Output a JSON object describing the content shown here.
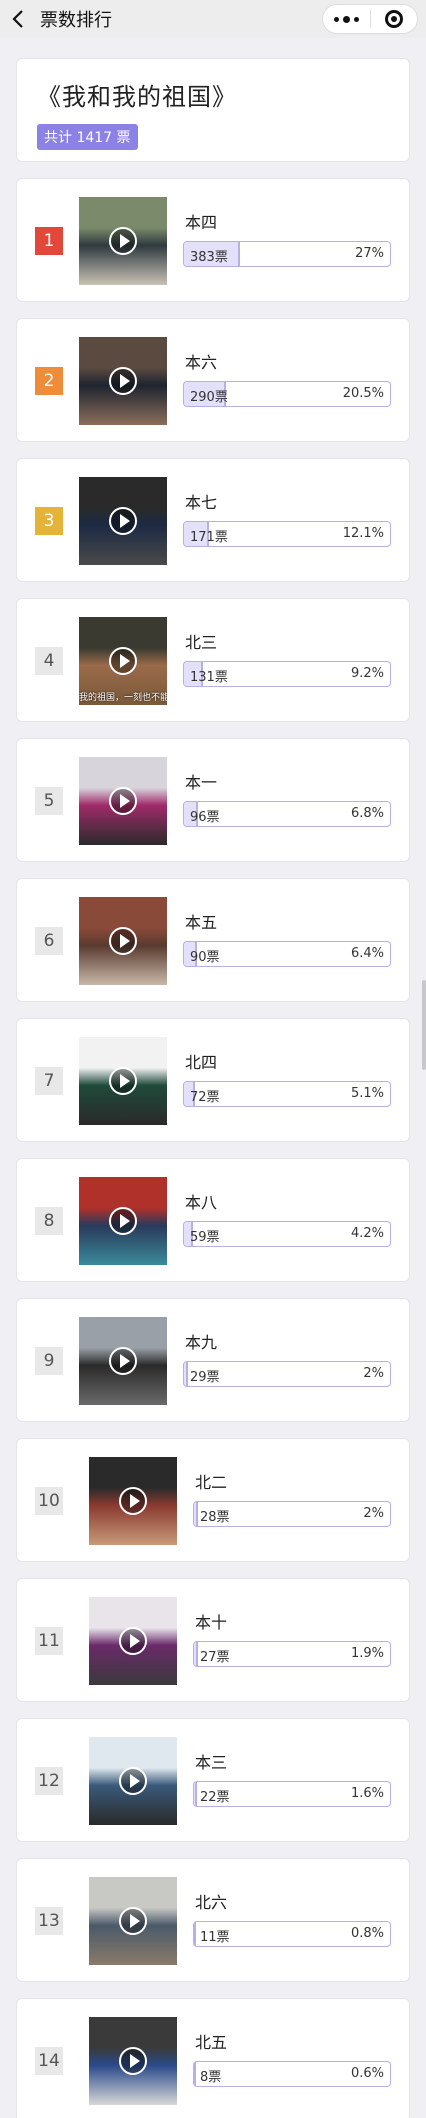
{
  "nav": {
    "title": "票数排行",
    "back_icon": "chevron-left-icon",
    "more_icon": "more-dots-icon",
    "close_icon": "mini-program-close-icon"
  },
  "summary": {
    "name": "《我和我的祖国》",
    "total": "共计 1417 票"
  },
  "colors": {
    "accent": "#8c82e6",
    "rank1": "#e2483a",
    "rank2": "#ee8c3a",
    "rank3": "#e5b23a",
    "bar_border": "#b6b0e8",
    "bar_fill": "#e3e0fa"
  },
  "items": [
    {
      "rank": "1",
      "cls": "本四",
      "votes": "383票",
      "pct": "27%",
      "share": 0.27,
      "thumb": [
        "#7a8a6a",
        "#2f3a40",
        "#c9c2b6"
      ],
      "caption": ""
    },
    {
      "rank": "2",
      "cls": "本六",
      "votes": "290票",
      "pct": "20.5%",
      "share": 0.205,
      "thumb": [
        "#5a4a40",
        "#1e2430",
        "#8b6e5a"
      ],
      "caption": ""
    },
    {
      "rank": "3",
      "cls": "本七",
      "votes": "171票",
      "pct": "12.1%",
      "share": 0.121,
      "thumb": [
        "#2a2a2a",
        "#1d2a44",
        "#4a4a4a"
      ],
      "caption": ""
    },
    {
      "rank": "4",
      "cls": "北三",
      "votes": "131票",
      "pct": "9.2%",
      "share": 0.092,
      "thumb": [
        "#3a3a30",
        "#9a6a4a",
        "#7a5a3a"
      ],
      "caption": "我的祖国，一刻也不能"
    },
    {
      "rank": "5",
      "cls": "本一",
      "votes": "96票",
      "pct": "6.8%",
      "share": 0.068,
      "thumb": [
        "#d8d4dc",
        "#a02a6a",
        "#2a2a2a"
      ],
      "caption": ""
    },
    {
      "rank": "6",
      "cls": "本五",
      "votes": "90票",
      "pct": "6.4%",
      "share": 0.064,
      "thumb": [
        "#8a4a3a",
        "#5a3a30",
        "#c8b8a8"
      ],
      "caption": ""
    },
    {
      "rank": "7",
      "cls": "北四",
      "votes": "72票",
      "pct": "5.1%",
      "share": 0.051,
      "thumb": [
        "#f2f2f2",
        "#1f4a3a",
        "#2a2a2a"
      ],
      "caption": ""
    },
    {
      "rank": "8",
      "cls": "本八",
      "votes": "59票",
      "pct": "4.2%",
      "share": 0.042,
      "thumb": [
        "#b0302a",
        "#2a3a5a",
        "#3a8a9a"
      ],
      "caption": ""
    },
    {
      "rank": "9",
      "cls": "本九",
      "votes": "29票",
      "pct": "2%",
      "share": 0.02,
      "thumb": [
        "#9aa0a8",
        "#2a2a2a",
        "#6a6a6a"
      ],
      "caption": ""
    },
    {
      "rank": "10",
      "cls": "北二",
      "votes": "28票",
      "pct": "2%",
      "share": 0.02,
      "thumb": [
        "#2a2a2a",
        "#8a3a30",
        "#c89a7a"
      ],
      "caption": ""
    },
    {
      "rank": "11",
      "cls": "本十",
      "votes": "27票",
      "pct": "1.9%",
      "share": 0.019,
      "thumb": [
        "#e8e4ea",
        "#6a2a6a",
        "#3a3a3a"
      ],
      "caption": ""
    },
    {
      "rank": "12",
      "cls": "本三",
      "votes": "22票",
      "pct": "1.6%",
      "share": 0.016,
      "thumb": [
        "#dfe8ee",
        "#3a5a7a",
        "#2a2a2a"
      ],
      "caption": ""
    },
    {
      "rank": "13",
      "cls": "北六",
      "votes": "11票",
      "pct": "0.8%",
      "share": 0.008,
      "thumb": [
        "#c8c8c4",
        "#4a5a6a",
        "#8a7a6a"
      ],
      "caption": ""
    },
    {
      "rank": "14",
      "cls": "北五",
      "votes": "8票",
      "pct": "0.6%",
      "share": 0.006,
      "thumb": [
        "#3a3a3a",
        "#2a4a8a",
        "#d8d8d8"
      ],
      "caption": ""
    }
  ]
}
